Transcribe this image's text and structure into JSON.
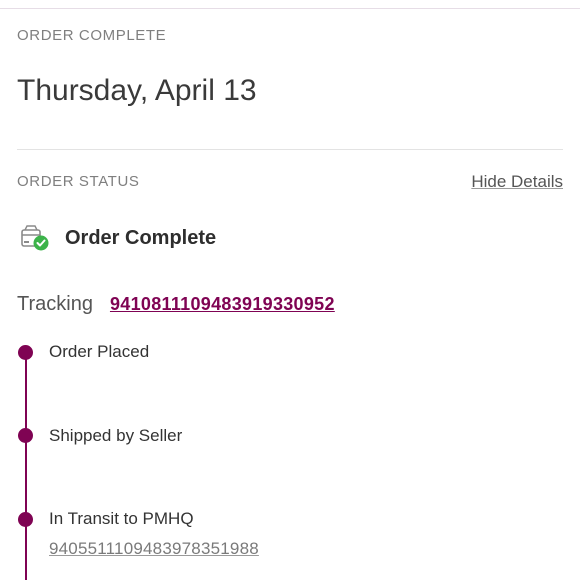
{
  "header": {
    "section_label": "ORDER COMPLETE",
    "date": "Thursday, April 13"
  },
  "order_status": {
    "section_label": "ORDER STATUS",
    "hide_details_label": "Hide Details",
    "status_text": "Order Complete",
    "status_icon": "package-check-icon"
  },
  "tracking": {
    "label": "Tracking",
    "number": "9410811109483919330952"
  },
  "timeline": {
    "steps": [
      {
        "label": "Order Placed"
      },
      {
        "label": "Shipped by Seller"
      },
      {
        "label": "In Transit to PMHQ",
        "sub_tracking": "9405511109483978351988"
      }
    ]
  },
  "colors": {
    "accent": "#7f0353",
    "success": "#3cb34a",
    "muted_text": "#7f7f7f"
  }
}
